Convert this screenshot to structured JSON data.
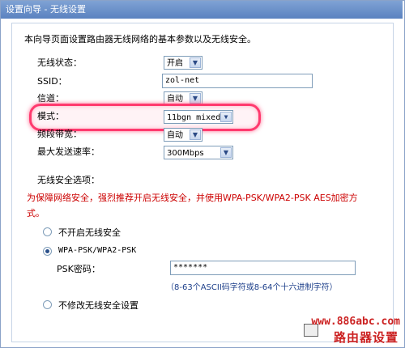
{
  "title": "设置向导 - 无线设置",
  "intro": "本向导页面设置路由器无线网络的基本参数以及无线安全。",
  "fields": {
    "status": {
      "label": "无线状态：",
      "value": "开启"
    },
    "ssid": {
      "label": "SSID：",
      "value": "zol-net"
    },
    "channel": {
      "label": "信道：",
      "value": "自动"
    },
    "mode": {
      "label": "模式：",
      "value": "11bgn mixed"
    },
    "bandwidth": {
      "label": "频段带宽：",
      "value": "自动"
    },
    "maxrate": {
      "label": "最大发送速率：",
      "value": "300Mbps"
    }
  },
  "security": {
    "heading": "无线安全选项：",
    "warning_line1": "为保障网络安全，强烈推荐开启无线安全，并使用WPA-PSK/WPA2-PSK AES加密方",
    "warning_line2": "式。",
    "opt_off": "不开启无线安全",
    "opt_wpa": "WPA-PSK/WPA2-PSK",
    "psk_label": "PSK密码：",
    "psk_value": "*******",
    "psk_hint": "（8-63个ASCII码字符或8-64个十六进制字符）",
    "opt_nochange": "不修改无线安全设置"
  },
  "watermark": {
    "url": "www.886abc.com",
    "text": "路由器设置"
  },
  "colors": {
    "accent": "#5a82c0",
    "warning": "#cc0000",
    "highlight": "#ff3a6e"
  }
}
